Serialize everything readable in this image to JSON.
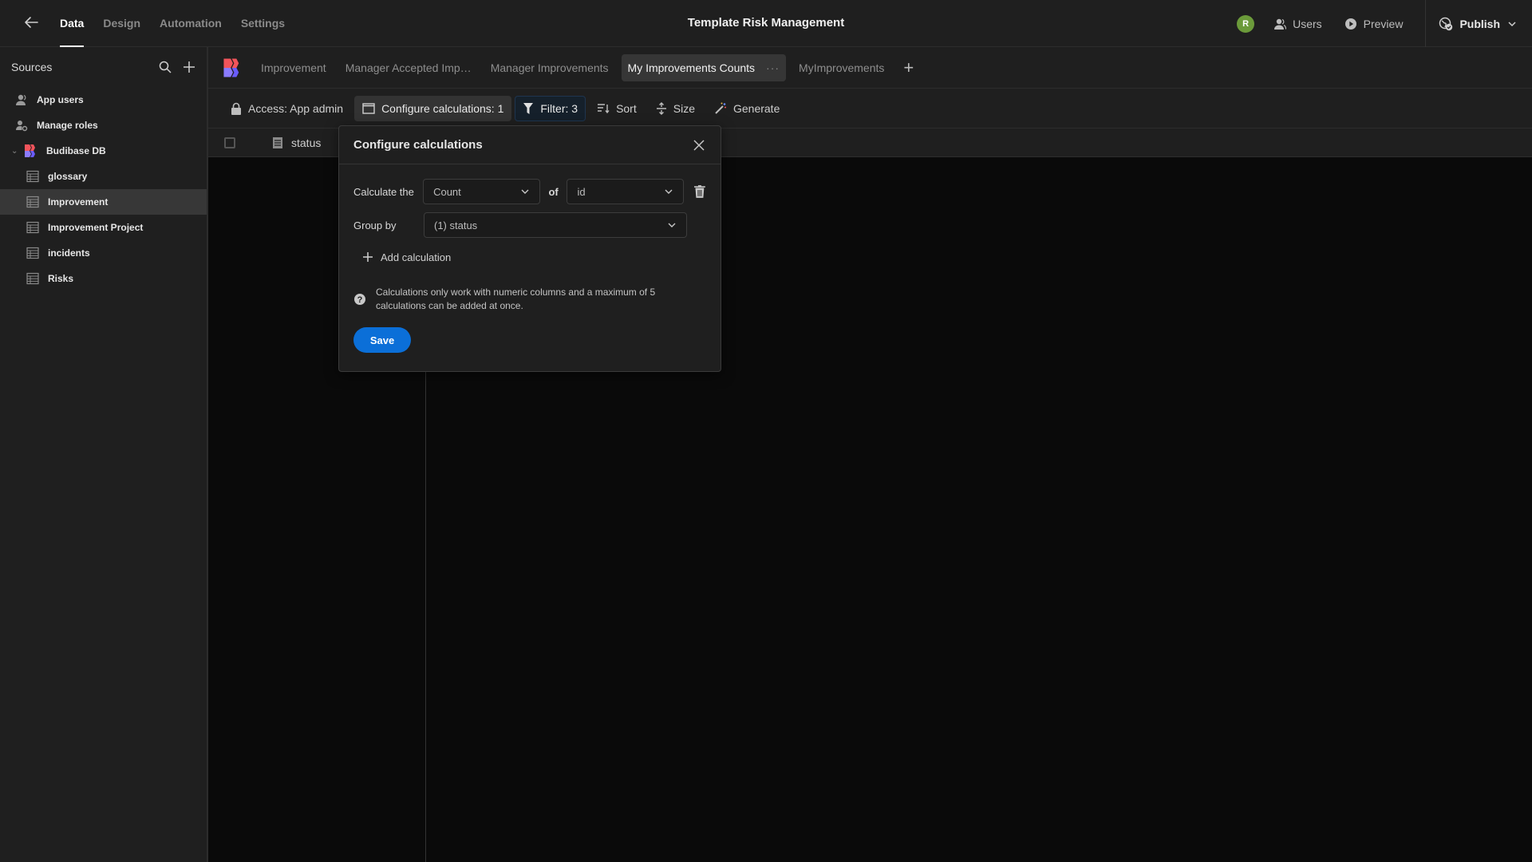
{
  "topbar": {
    "nav_tabs": [
      "Data",
      "Design",
      "Automation",
      "Settings"
    ],
    "active_nav": "Data",
    "app_title": "Template Risk Management",
    "avatar_initial": "R",
    "avatar_color": "#6b9a3a",
    "users_label": "Users",
    "preview_label": "Preview",
    "publish_label": "Publish"
  },
  "sidebar": {
    "title": "Sources",
    "items": [
      {
        "label": "App users",
        "icon": "user-icon",
        "level": 0
      },
      {
        "label": "Manage roles",
        "icon": "user-gear-icon",
        "level": 0
      },
      {
        "label": "Budibase DB",
        "icon": "budibase-logo",
        "level": 0,
        "expanded": true
      },
      {
        "label": "glossary",
        "icon": "table-icon",
        "level": 1
      },
      {
        "label": "Improvement",
        "icon": "table-icon",
        "level": 1,
        "active": true
      },
      {
        "label": "Improvement Project",
        "icon": "table-icon",
        "level": 1
      },
      {
        "label": "incidents",
        "icon": "table-icon",
        "level": 1
      },
      {
        "label": "Risks",
        "icon": "table-icon",
        "level": 1
      }
    ]
  },
  "view_tabs": {
    "tabs": [
      {
        "label": "Improvement"
      },
      {
        "label": "Manager Accepted Imp…"
      },
      {
        "label": "Manager Improvements"
      },
      {
        "label": "My Improvements Counts",
        "active": true
      },
      {
        "label": "MyImprovements"
      }
    ],
    "more_label": "···"
  },
  "toolbar": {
    "access_label": "Access: App admin",
    "calc_label": "Configure calculations: 1",
    "filter_label": "Filter: 3",
    "sort_label": "Sort",
    "size_label": "Size",
    "generate_label": "Generate"
  },
  "grid": {
    "column_header": "status"
  },
  "modal": {
    "title": "Configure calculations",
    "calculate_label": "Calculate the",
    "calculation_type": "Count",
    "of_label": "of",
    "field": "id",
    "group_by_label": "Group by",
    "group_by_value": "(1) status",
    "add_calculation_label": "Add calculation",
    "info_text": "Calculations only work with numeric columns and a maximum of 5 calculations can be added at once.",
    "save_label": "Save",
    "accent_color": "#0b6fd8"
  }
}
